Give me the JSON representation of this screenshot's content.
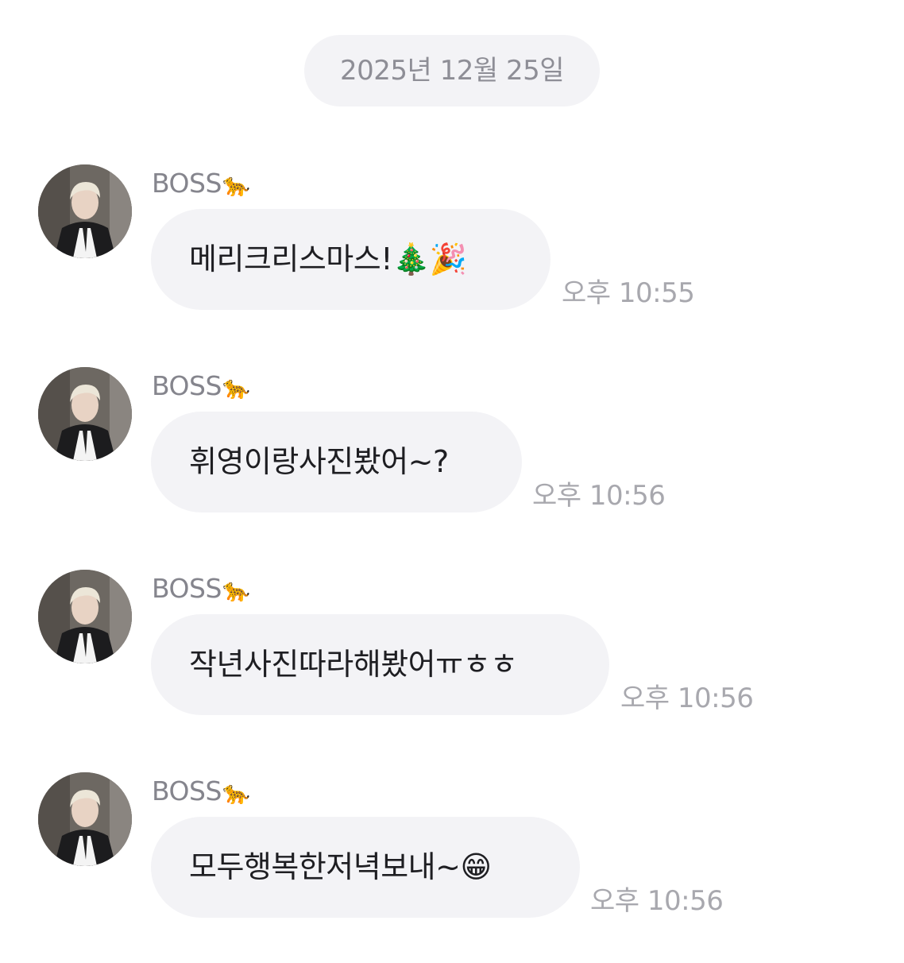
{
  "chat": {
    "date": "2025년 12월 25일",
    "messages": [
      {
        "sender": "BOSS",
        "sender_emoji": "🐆",
        "text": "메리크리스마스!",
        "emoji": "🎄🎉",
        "time": "오후 10:55"
      },
      {
        "sender": "BOSS",
        "sender_emoji": "🐆",
        "text": "휘영이랑사진봤어~?",
        "emoji": "",
        "time": "오후 10:56"
      },
      {
        "sender": "BOSS",
        "sender_emoji": "🐆",
        "text": "작년사진따라해봤어ㅠㅎㅎ",
        "emoji": "",
        "time": "오후 10:56"
      },
      {
        "sender": "BOSS",
        "sender_emoji": "🐆",
        "text": "모두행복한저녁보내~",
        "emoji": "😁",
        "time": "오후 10:56"
      }
    ]
  },
  "colors": {
    "bubble_bg": "#f3f3f6",
    "bubble_text": "#1e1e22",
    "sender_text": "#85858d",
    "time_text": "#a8a8ae",
    "date_text": "#8e8e96"
  }
}
